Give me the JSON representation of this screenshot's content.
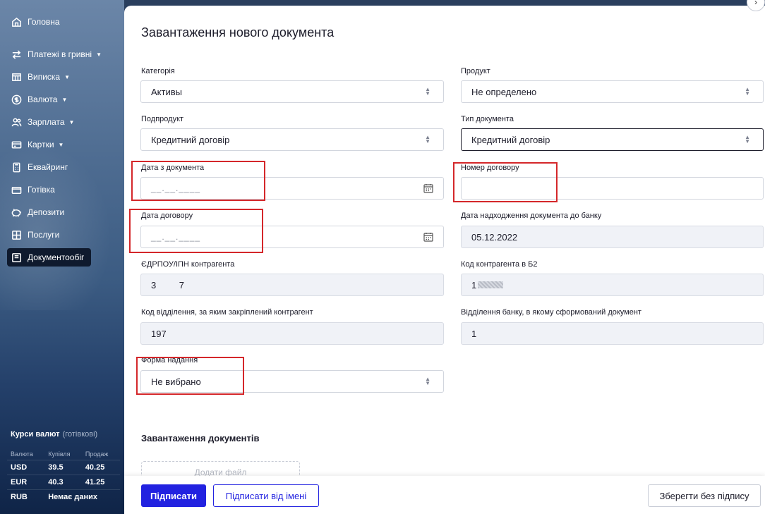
{
  "sidebar": {
    "items": [
      {
        "label": "Головна",
        "icon": "home-icon",
        "dropdown": false
      },
      {
        "label": "Платежі в гривні",
        "icon": "transfer-icon",
        "dropdown": true
      },
      {
        "label": "Виписка",
        "icon": "statement-icon",
        "dropdown": true
      },
      {
        "label": "Валюта",
        "icon": "currency-icon",
        "dropdown": true
      },
      {
        "label": "Зарплата",
        "icon": "users-icon",
        "dropdown": true
      },
      {
        "label": "Картки",
        "icon": "card-icon",
        "dropdown": true
      },
      {
        "label": "Еквайринг",
        "icon": "terminal-icon",
        "dropdown": false
      },
      {
        "label": "Готівка",
        "icon": "cash-icon",
        "dropdown": false
      },
      {
        "label": "Депозити",
        "icon": "piggy-bank-icon",
        "dropdown": false
      },
      {
        "label": "Послуги",
        "icon": "grid-icon",
        "dropdown": false
      },
      {
        "label": "Документообіг",
        "icon": "document-icon",
        "dropdown": false,
        "active": true
      }
    ],
    "rates": {
      "title": "Курси валют",
      "subtitle": "(готівкові)",
      "headers": [
        "Валюта",
        "Купівля",
        "Продаж"
      ],
      "rows": [
        {
          "currency": "USD",
          "buy": "39.5",
          "sell": "40.25"
        },
        {
          "currency": "EUR",
          "buy": "40.3",
          "sell": "41.25"
        },
        {
          "currency": "RUB",
          "note": "Немає даних"
        }
      ]
    }
  },
  "form": {
    "title": "Завантаження нового документа",
    "category": {
      "label": "Категорія",
      "value": "Активы"
    },
    "product": {
      "label": "Продукт",
      "value": "Не определено"
    },
    "subproduct": {
      "label": "Подпродукт",
      "value": "Кредитний договір"
    },
    "doc_type": {
      "label": "Тип документа",
      "value": "Кредитний договір"
    },
    "doc_date": {
      "label": "Дата з документа",
      "mask": "__.__.____"
    },
    "contract_number": {
      "label": "Номер договору",
      "value": ""
    },
    "contract_date": {
      "label": "Дата договору",
      "mask": "__.__.____"
    },
    "received_date": {
      "label": "Дата надходження документа до банку",
      "value": "05.12.2022"
    },
    "edrpou": {
      "label": "ЄДРПОУ/ІПН контрагента",
      "value": "3         7"
    },
    "counterparty_code": {
      "label": "Код контрагента в Б2",
      "value": "1"
    },
    "branch_code": {
      "label": "Код відділення, за яким закріплений контрагент",
      "value": "197"
    },
    "bank_branch": {
      "label": "Відділення банку, в якому сформований документ",
      "value": "1"
    },
    "form_type": {
      "label": "Форма надання",
      "value": "Не вибрано"
    },
    "upload_section": "Завантаження документів",
    "add_file": "Додати файл"
  },
  "footer": {
    "sign": "Підписати",
    "sign_on_behalf": "Підписати від імені",
    "save_unsigned": "Зберегти без підпису"
  },
  "colors": {
    "primary": "#2222e0",
    "annotation": "#d4272a"
  }
}
